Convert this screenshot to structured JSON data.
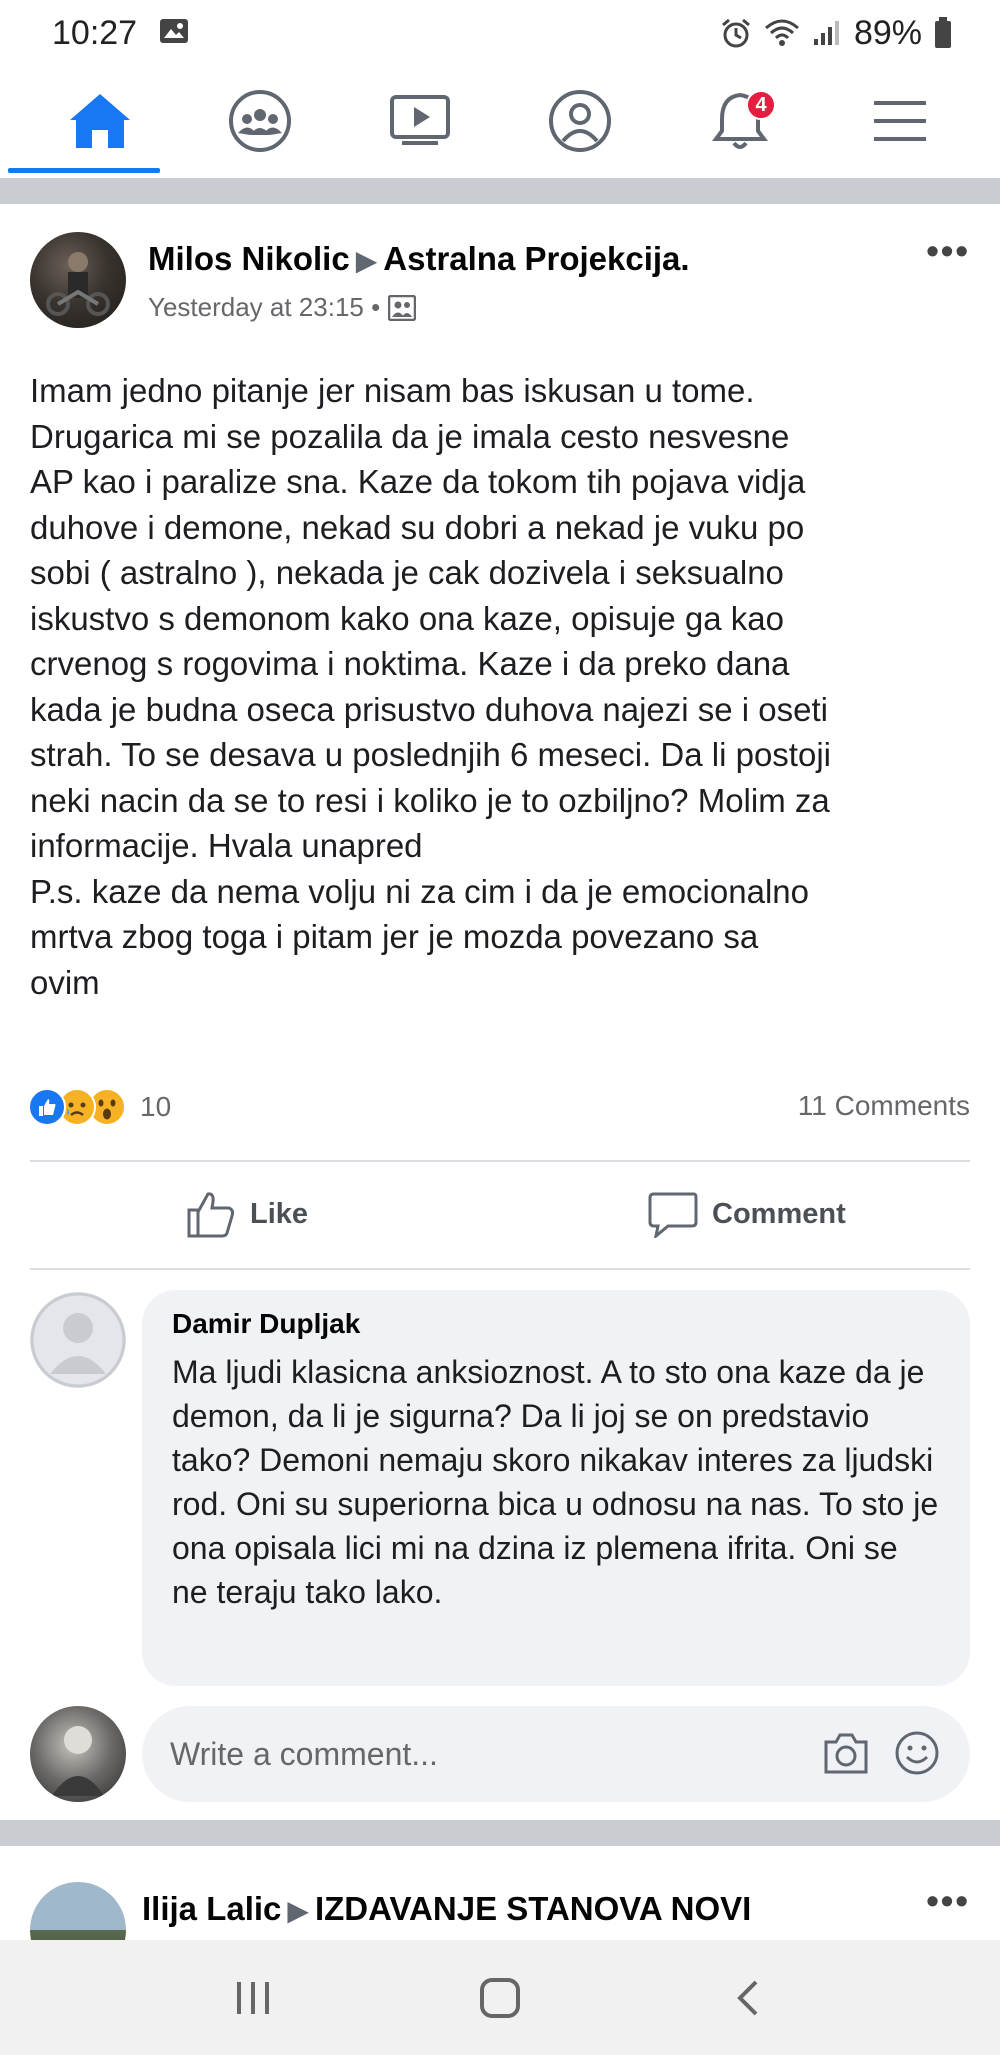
{
  "status_bar": {
    "time": "10:27",
    "battery": "89%"
  },
  "nav": {
    "items": [
      "home",
      "groups",
      "watch",
      "profile",
      "notifications",
      "menu"
    ],
    "notification_badge": "4",
    "accent_color": "#1877f2"
  },
  "post": {
    "author": "Milos Nikolic",
    "group": "Astralna Projekcija.",
    "timestamp": "Yesterday at 23:15 •",
    "body": "Imam jedno pitanje jer nisam bas iskusan u tome.\nDrugarica mi se pozalila da je imala cesto nesvesne\nAP kao i paralize sna. Kaze da tokom tih pojava vidja\nduhove i demone, nekad su dobri a nekad je vuku po\nsobi ( astralno ), nekada je cak dozivela i seksualno\niskustvo s demonom kako ona kaze, opisuje ga kao\ncrvenog s rogovima i noktima. Kaze i da preko dana\nkada je budna oseca prisustvo duhova najezi se i oseti\nstrah. To se desava u poslednjih 6 meseci. Da li postoji\nneki nacin da se to resi i koliko je to ozbiljno? Molim za\ninformacije. Hvala unapred\nP.s. kaze da nema volju ni za cim i da je emocionalno\nmrtva zbog toga i pitam jer je mozda povezano sa\novim",
    "reaction_count": "10",
    "comments_count": "11 Comments",
    "like_label": "Like",
    "comment_label": "Comment"
  },
  "comment": {
    "author": "Damir Dupljak",
    "text": "Ma ljudi klasicna anksioznost. A to sto ona kaze da je demon, da li je sigurna? Da li joj se on predstavio tako? Demoni nemaju skoro nikakav interes za ljudski rod. Oni su superiorna bica u odnosu na nas. To sto je ona opisala lici mi na dzina iz plemena ifrita. Oni se ne teraju tako lako."
  },
  "write_comment": {
    "placeholder": "Write a comment..."
  },
  "next_post": {
    "author": "Ilija Lalic",
    "group": "IZDAVANJE STANOVA NOVI"
  }
}
